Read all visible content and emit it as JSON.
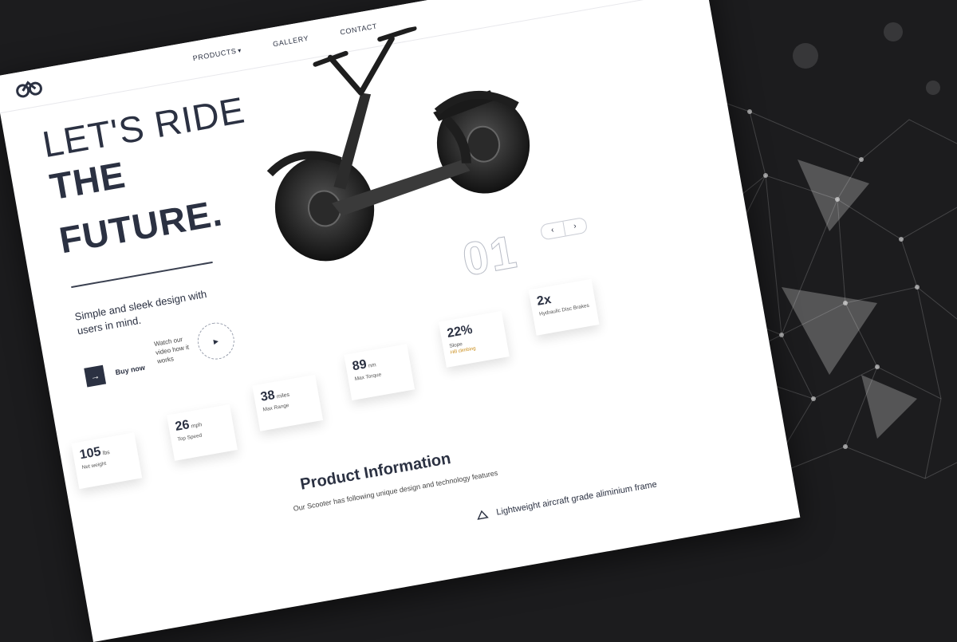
{
  "nav": {
    "items": [
      {
        "label": "PRODUCTS",
        "has_dropdown": true
      },
      {
        "label": "GALLERY"
      },
      {
        "label": "CONTACT"
      }
    ]
  },
  "hero": {
    "line1": "LET'S RIDE",
    "line2": "THE",
    "line3": "FUTURE.",
    "subtitle": "Simple and sleek design with users in mind.",
    "buy_label": "Buy now",
    "video_text": "Watch our video how it works"
  },
  "slider": {
    "number": "01",
    "prev": "‹",
    "next": "›"
  },
  "stats": [
    {
      "value": "105",
      "unit": "lbs",
      "label": "Net weight",
      "sublabel": ""
    },
    {
      "value": "26",
      "unit": "mph",
      "label": "Top Speed",
      "sublabel": ""
    },
    {
      "value": "38",
      "unit": "miles",
      "label": "Max Range",
      "sublabel": ""
    },
    {
      "value": "89",
      "unit": "nm",
      "label": "Max Torque",
      "sublabel": ""
    },
    {
      "value": "22%",
      "unit": "",
      "label": "Slope",
      "sublabel": "Hill climbing"
    },
    {
      "value": "2x",
      "unit": "",
      "label": "Hydraulic Disc Brakes",
      "sublabel": ""
    }
  ],
  "product_info": {
    "title": "Product Information",
    "subtitle": "Our Scooter has following unique design and technology features",
    "feature1": "Lightweight aircraft grade aliminium frame"
  },
  "icons": {
    "logo": "bike-logo-icon",
    "buy": "arrow-right-icon",
    "play": "play-icon",
    "feature": "frame-icon"
  }
}
